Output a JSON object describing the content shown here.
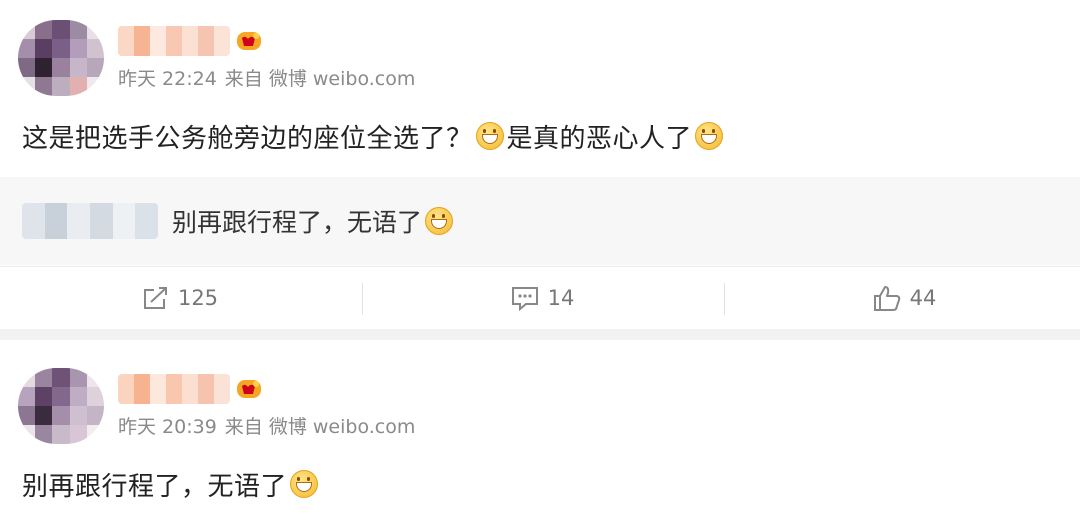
{
  "post1": {
    "time": "昨天 22:24",
    "source": "来自 微博 weibo.com",
    "text_part1": "这是把选手公务舱旁边的座位全选了？",
    "text_part2": "是真的恶心人了",
    "reply": {
      "text": "别再跟行程了，无语了"
    },
    "actions": {
      "repost_count": "125",
      "comment_count": "14",
      "like_count": "44"
    }
  },
  "post2": {
    "time": "昨天 20:39",
    "source": "来自 微博 weibo.com",
    "text": "别再跟行程了，无语了"
  },
  "icons": [
    "vip-badge-icon",
    "grin-emoji-icon",
    "smile-emoji-icon",
    "repost-icon",
    "comment-icon",
    "like-icon"
  ],
  "colors": {
    "background": "#f2f2f2",
    "card": "#ffffff",
    "meta_text": "#8a8a8a",
    "reply_bg": "#f7f7f7"
  }
}
